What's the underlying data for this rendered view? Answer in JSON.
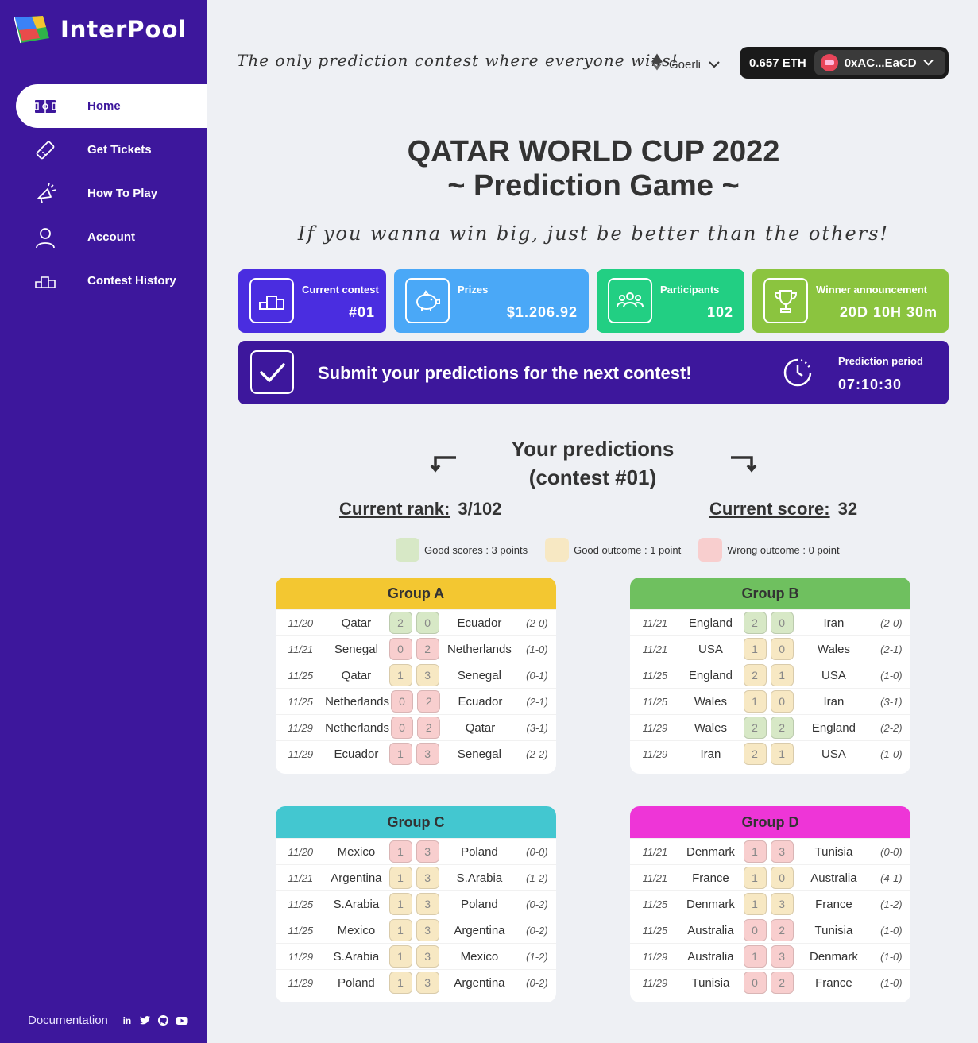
{
  "app": {
    "name": "InterPool"
  },
  "sidebar": {
    "items": [
      {
        "label": "Home",
        "icon": "field-icon"
      },
      {
        "label": "Get Tickets",
        "icon": "ticket-icon"
      },
      {
        "label": "How To Play",
        "icon": "megaphone-icon"
      },
      {
        "label": "Account",
        "icon": "user-icon"
      },
      {
        "label": "Contest History",
        "icon": "podium-icon"
      }
    ],
    "active": "Home",
    "documentation": "Documentation",
    "social": [
      "linkedin-icon",
      "twitter-icon",
      "github-icon",
      "youtube-icon"
    ]
  },
  "header": {
    "tagline": "The only prediction contest where everyone wins!",
    "network": "Goerli",
    "balance": "0.657 ETH",
    "address": "0xAC...EaCD"
  },
  "hero": {
    "title": "QATAR WORLD CUP 2022",
    "subtitle_game": "~ Prediction Game ~",
    "motto": "If you wanna win big, just be better than the others!"
  },
  "stats": {
    "current_contest": {
      "label": "Current contest",
      "value": "#01"
    },
    "prizes": {
      "label": "Prizes",
      "value": "$1.206.92"
    },
    "participants": {
      "label": "Participants",
      "value": "102"
    },
    "winner": {
      "label": "Winner announcement",
      "value": "20D 10H 30m"
    }
  },
  "banner": {
    "message": "Submit your predictions for the next contest!",
    "period_label": "Prediction period",
    "period_value": "07:10:30"
  },
  "predictions": {
    "title_line1": "Your predictions",
    "title_line2": "(contest #01)",
    "rank_label": "Current rank:",
    "rank_value": "3/102",
    "score_label": "Current score:",
    "score_value": "32"
  },
  "legend": {
    "good_scores": "Good scores : 3 points",
    "good_outcome": "Good outcome : 1 point",
    "wrong_outcome": "Wrong outcome : 0 point",
    "colors": {
      "good_scores": "#d7e8c6",
      "good_outcome": "#f7e8c3",
      "wrong_outcome": "#f8cece"
    }
  },
  "groups": [
    {
      "name": "Group A",
      "color": "#f3c731",
      "matches": [
        {
          "date": "11/20",
          "home": "Qatar",
          "h": "2",
          "a": "0",
          "away": "Ecuador",
          "result": "(2-0)",
          "status": "g"
        },
        {
          "date": "11/21",
          "home": "Senegal",
          "h": "0",
          "a": "2",
          "away": "Netherlands",
          "result": "(1-0)",
          "status": "r"
        },
        {
          "date": "11/25",
          "home": "Qatar",
          "h": "1",
          "a": "3",
          "away": "Senegal",
          "result": "(0-1)",
          "status": "y"
        },
        {
          "date": "11/25",
          "home": "Netherlands",
          "h": "0",
          "a": "2",
          "away": "Ecuador",
          "result": "(2-1)",
          "status": "r"
        },
        {
          "date": "11/29",
          "home": "Netherlands",
          "h": "0",
          "a": "2",
          "away": "Qatar",
          "result": "(3-1)",
          "status": "r"
        },
        {
          "date": "11/29",
          "home": "Ecuador",
          "h": "1",
          "a": "3",
          "away": "Senegal",
          "result": "(2-2)",
          "status": "r"
        }
      ]
    },
    {
      "name": "Group B",
      "color": "#6fc05f",
      "matches": [
        {
          "date": "11/21",
          "home": "England",
          "h": "2",
          "a": "0",
          "away": "Iran",
          "result": "(2-0)",
          "status": "g"
        },
        {
          "date": "11/21",
          "home": "USA",
          "h": "1",
          "a": "0",
          "away": "Wales",
          "result": "(2-1)",
          "status": "y"
        },
        {
          "date": "11/25",
          "home": "England",
          "h": "2",
          "a": "1",
          "away": "USA",
          "result": "(1-0)",
          "status": "y"
        },
        {
          "date": "11/25",
          "home": "Wales",
          "h": "1",
          "a": "0",
          "away": "Iran",
          "result": "(3-1)",
          "status": "y"
        },
        {
          "date": "11/29",
          "home": "Wales",
          "h": "2",
          "a": "2",
          "away": "England",
          "result": "(2-2)",
          "status": "g"
        },
        {
          "date": "11/29",
          "home": "Iran",
          "h": "2",
          "a": "1",
          "away": "USA",
          "result": "(1-0)",
          "status": "y"
        }
      ]
    },
    {
      "name": "Group C",
      "color": "#43c7d0",
      "matches": [
        {
          "date": "11/20",
          "home": "Mexico",
          "h": "1",
          "a": "3",
          "away": "Poland",
          "result": "(0-0)",
          "status": "r"
        },
        {
          "date": "11/21",
          "home": "Argentina",
          "h": "1",
          "a": "3",
          "away": "S.Arabia",
          "result": "(1-2)",
          "status": "y"
        },
        {
          "date": "11/25",
          "home": "S.Arabia",
          "h": "1",
          "a": "3",
          "away": "Poland",
          "result": "(0-2)",
          "status": "y"
        },
        {
          "date": "11/25",
          "home": "Mexico",
          "h": "1",
          "a": "3",
          "away": "Argentina",
          "result": "(0-2)",
          "status": "y"
        },
        {
          "date": "11/29",
          "home": "S.Arabia",
          "h": "1",
          "a": "3",
          "away": "Mexico",
          "result": "(1-2)",
          "status": "y"
        },
        {
          "date": "11/29",
          "home": "Poland",
          "h": "1",
          "a": "3",
          "away": "Argentina",
          "result": "(0-2)",
          "status": "y"
        }
      ]
    },
    {
      "name": "Group D",
      "color": "#ee35d7",
      "matches": [
        {
          "date": "11/21",
          "home": "Denmark",
          "h": "1",
          "a": "3",
          "away": "Tunisia",
          "result": "(0-0)",
          "status": "r"
        },
        {
          "date": "11/21",
          "home": "France",
          "h": "1",
          "a": "0",
          "away": "Australia",
          "result": "(4-1)",
          "status": "y"
        },
        {
          "date": "11/25",
          "home": "Denmark",
          "h": "1",
          "a": "3",
          "away": "France",
          "result": "(1-2)",
          "status": "y"
        },
        {
          "date": "11/25",
          "home": "Australia",
          "h": "0",
          "a": "2",
          "away": "Tunisia",
          "result": "(1-0)",
          "status": "r"
        },
        {
          "date": "11/29",
          "home": "Australia",
          "h": "1",
          "a": "3",
          "away": "Denmark",
          "result": "(1-0)",
          "status": "r"
        },
        {
          "date": "11/29",
          "home": "Tunisia",
          "h": "0",
          "a": "2",
          "away": "France",
          "result": "(1-0)",
          "status": "r"
        }
      ]
    }
  ]
}
